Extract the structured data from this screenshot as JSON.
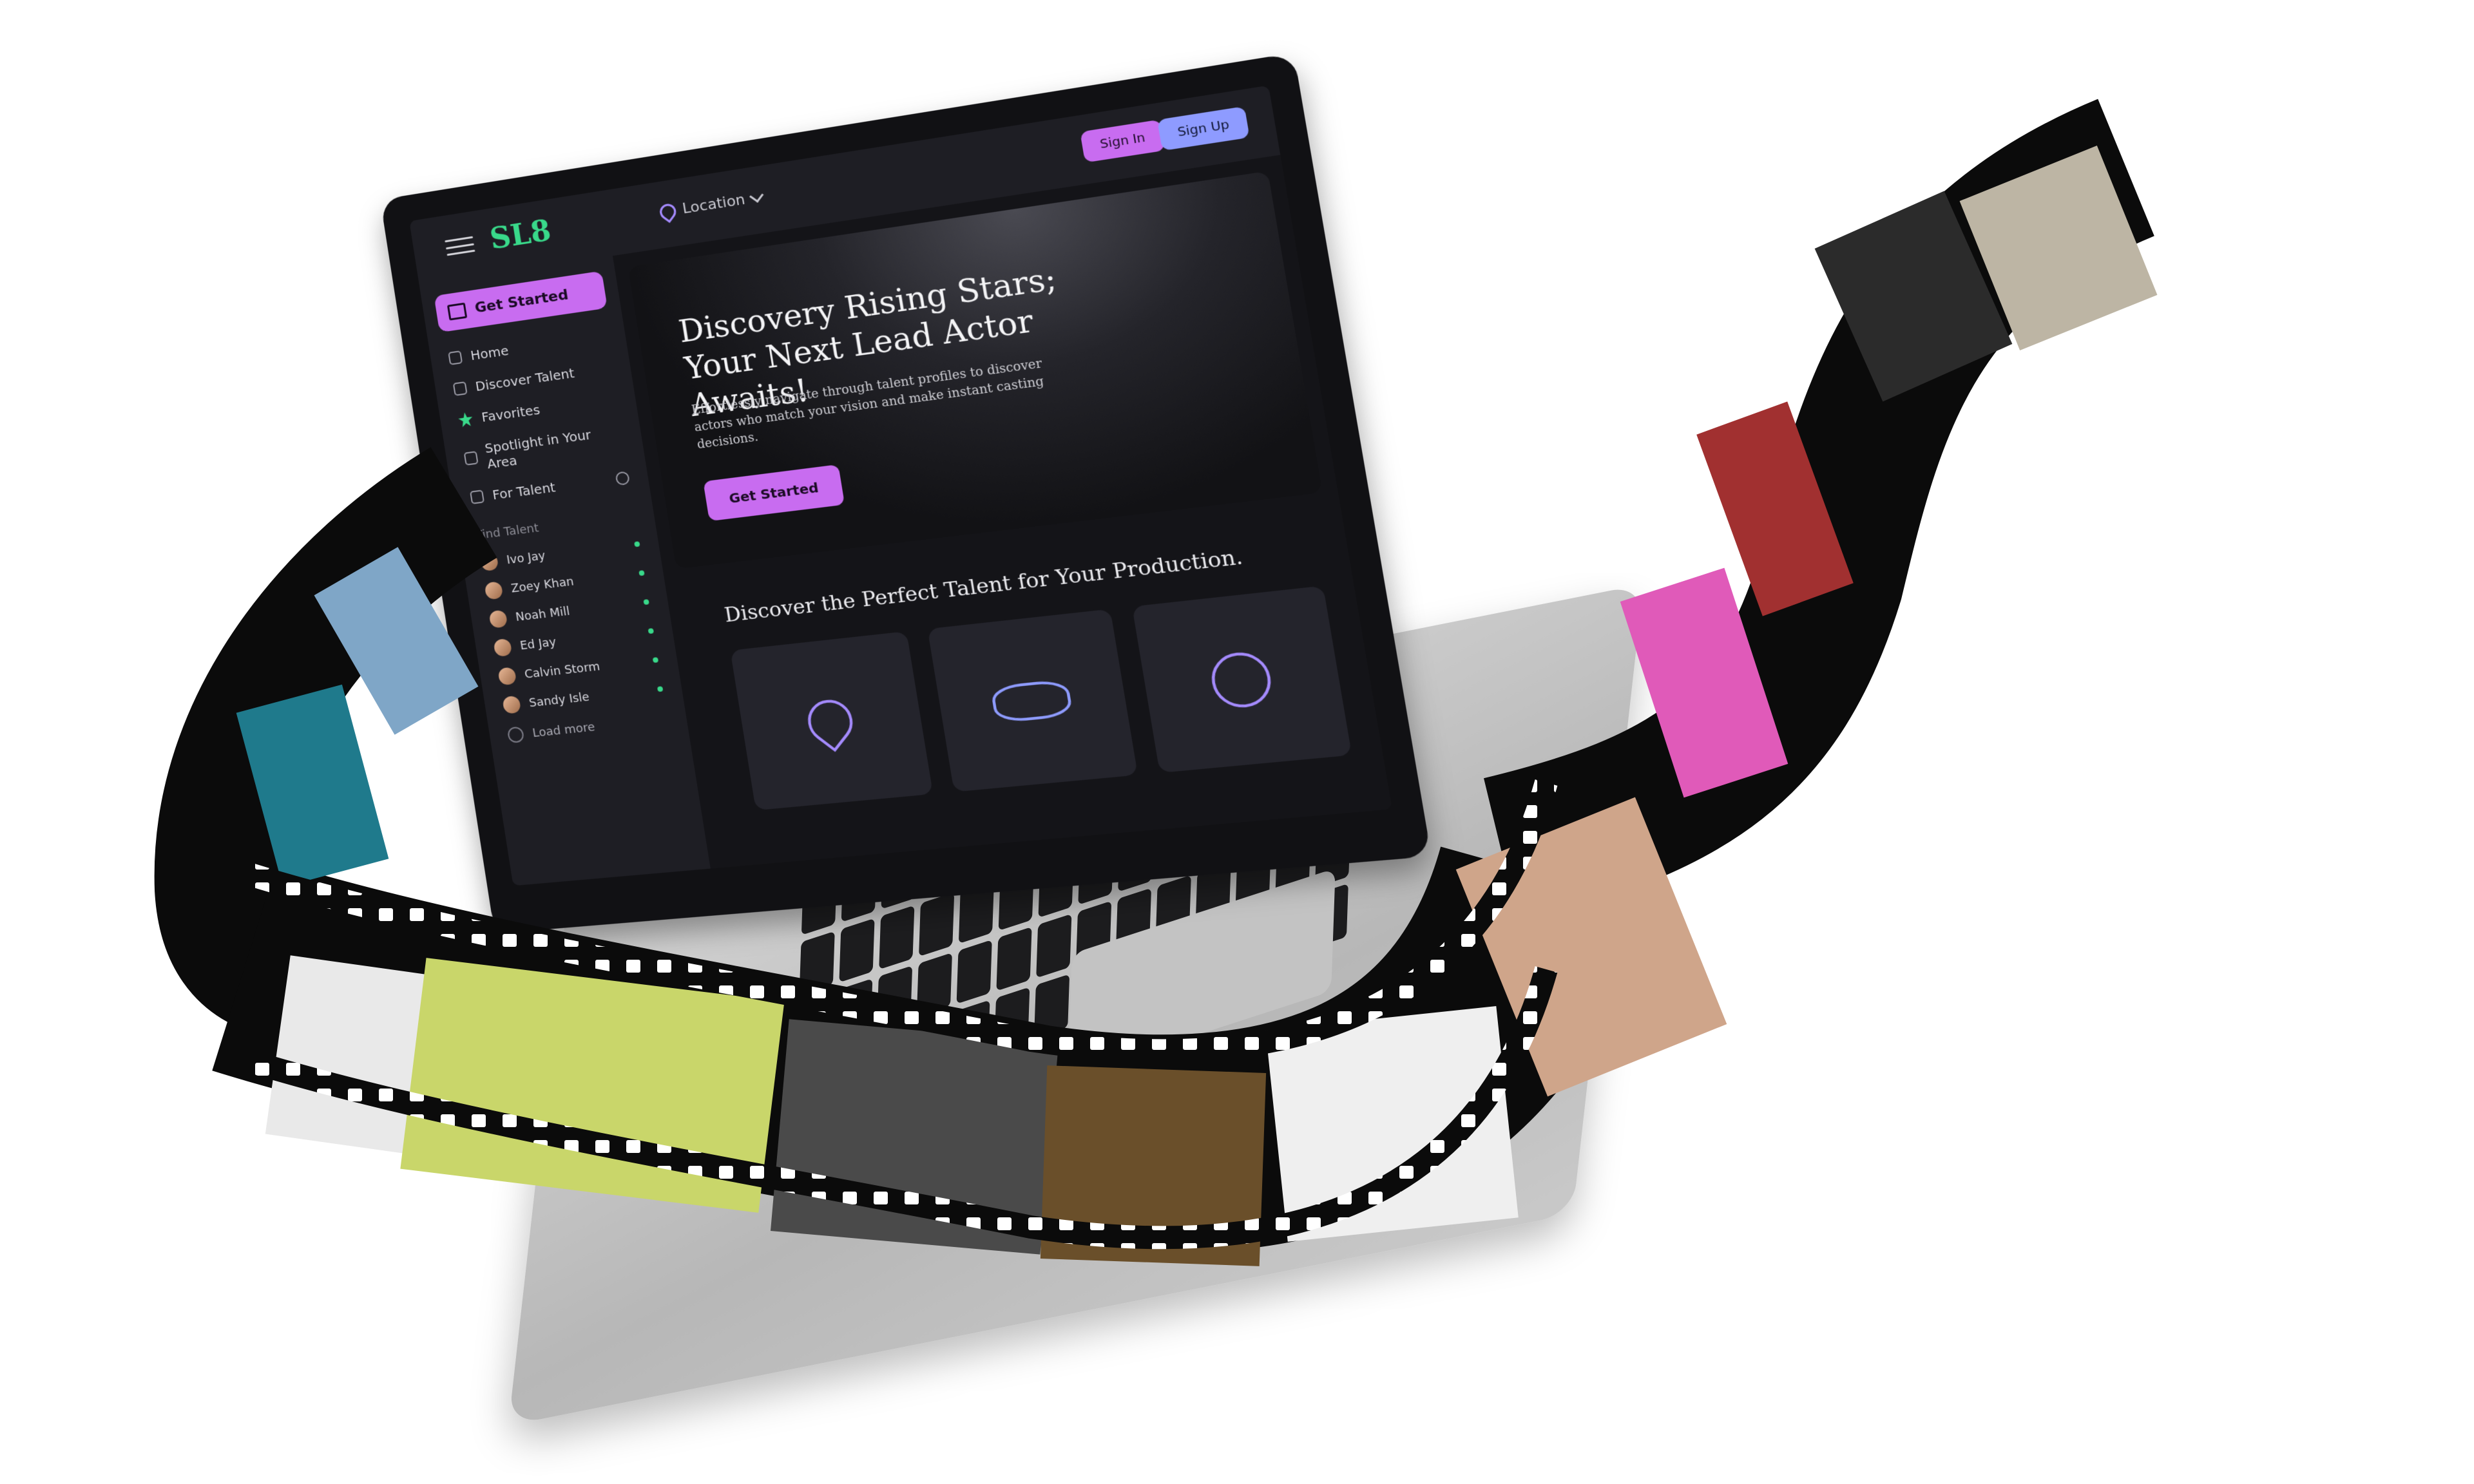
{
  "app": {
    "logo_text": "SL8",
    "location_label": "Location",
    "sign_in_label": "Sign In",
    "sign_up_label": "Sign Up"
  },
  "sidebar": {
    "get_started_label": "Get Started",
    "nav": [
      {
        "label": "Home",
        "icon": "home-icon"
      },
      {
        "label": "Discover Talent",
        "icon": "compass-icon"
      },
      {
        "label": "Favorites",
        "icon": "star-icon"
      },
      {
        "label": "Spotlight in Your Area",
        "icon": "map-icon"
      },
      {
        "label": "For Talent",
        "icon": "user-icon"
      }
    ],
    "find_talent_label": "Find Talent",
    "talents": [
      "Ivo Jay",
      "Zoey Khan",
      "Noah Mill",
      "Ed Jay",
      "Calvin Storm",
      "Sandy Isle"
    ],
    "load_more_label": "Load more"
  },
  "hero": {
    "title": "Discovery Rising Stars; Your Next Lead Actor Awaits!",
    "subtitle": "Effortlessly navigate through talent profiles to discover actors who match your vision and make instant casting decisions.",
    "cta_label": "Get Started"
  },
  "section": {
    "title": "Discover the Perfect Talent for Your Production."
  },
  "colors": {
    "accent_purple": "#c86cf0",
    "accent_blue": "#8e9bff",
    "accent_green": "#39d98a",
    "screen_bg": "#141418"
  }
}
